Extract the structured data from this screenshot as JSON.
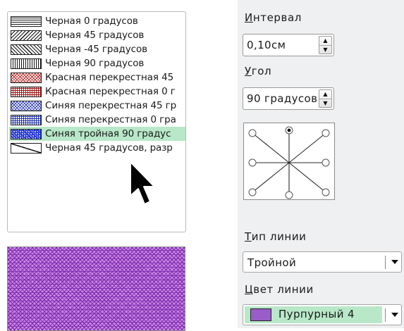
{
  "hatch_list": {
    "items": [
      {
        "label": "Черная 0 градусов",
        "swatch": "sw-h"
      },
      {
        "label": "Черная 45 градусов",
        "swatch": "sw-45"
      },
      {
        "label": "Черная -45 градусов",
        "swatch": "sw-m45"
      },
      {
        "label": "Черная 90 градусов",
        "swatch": "sw-v"
      },
      {
        "label": "Красная перекрестная 45",
        "swatch": "sw-red45"
      },
      {
        "label": "Красная перекрестная 0 г",
        "swatch": "sw-red0"
      },
      {
        "label": "Синяя перекрестная 45 гр",
        "swatch": "sw-blue45"
      },
      {
        "label": "Синяя перекрестная 0 гра",
        "swatch": "sw-blue0"
      },
      {
        "label": "Синяя тройная 90 градус",
        "swatch": "sw-blue90t",
        "selected": true
      },
      {
        "label": "Черная 45 градусов, разр",
        "swatch": "sw-diag"
      }
    ]
  },
  "spacing": {
    "label_accel": "И",
    "label_rest": "нтервал",
    "value": "0,10см"
  },
  "angle": {
    "label_accel": "У",
    "label_rest": "гол",
    "value": "90 градусов"
  },
  "line_type": {
    "label_accel": "Т",
    "label_rest": "ип линии",
    "value": "Тройной"
  },
  "line_color": {
    "label_accel": "Ц",
    "label_rest": "вет линии",
    "value": "Пурпурный 4",
    "color": "#9a5cc8"
  },
  "colors": {
    "selection": "#b8e8c8",
    "panel_bg": "#eff0f1",
    "preview_fill": "#cc88e8",
    "preview_lines": "#7a2aa8"
  },
  "icons": {
    "spin_up": "▲",
    "spin_down": "▼",
    "cursor": "arrow-cursor-icon"
  }
}
